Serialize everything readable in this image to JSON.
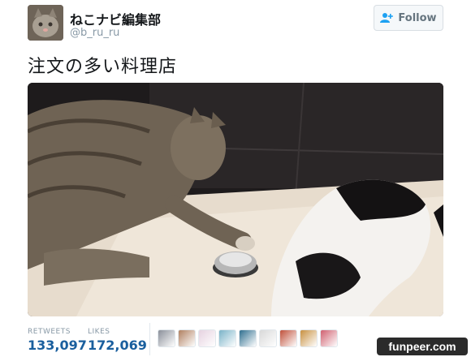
{
  "user": {
    "display_name": "ねこナビ編集部",
    "screen_name": "@b_ru_ru",
    "follow_label": "Follow"
  },
  "tweet": {
    "text": "注文の多い料理店"
  },
  "stats": {
    "retweets_label": "RETWEETS",
    "retweets_value": "133,097",
    "likes_label": "LIKES",
    "likes_value": "172,069"
  },
  "likers": [
    "#8a8f99",
    "#b08060",
    "#e6d2e0",
    "#7ab3c8",
    "#2f6f8f",
    "#d8d8d8",
    "#c0503a",
    "#c89040",
    "#d06070"
  ],
  "watermark": "funpeer.com",
  "colors": {
    "accent": "#1a5f9e",
    "muted": "#8899a6"
  }
}
